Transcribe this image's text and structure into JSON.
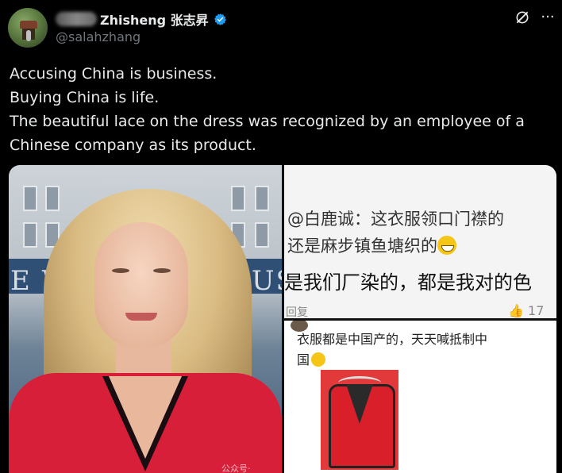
{
  "author": {
    "display_name": "Zhisheng 张志昇",
    "handle": "@salahzhang",
    "verified": true
  },
  "header_icons": {
    "grok": "grok-icon",
    "more": "more-icon",
    "more_glyph": "···"
  },
  "tweet": {
    "lines": [
      "Accusing China is business.",
      "Buying China is life.",
      "The beautiful lace on the dress was recognized by an employee of a",
      "Chinese company as its product."
    ]
  },
  "media": {
    "left": {
      "backdrop_letters": "E W",
      "backdrop_letters2": "OUS",
      "backdrop_small": "W",
      "watermark": "公众号·"
    },
    "right_top": {
      "line1": "@白鹿诚：这衣服领口门襟的",
      "line2": "还是麻步镇鱼塘织的",
      "line3": "是我们厂染的，都是我对的色",
      "reply": "回复",
      "likes": "17"
    },
    "right_bottom": {
      "line1": "衣服都是中国产的，天天喊抵制中",
      "line2": "国"
    }
  },
  "colors": {
    "background": "#000000",
    "text": "#e7e9ea",
    "muted": "#71767b",
    "verified": "#1d9bf0"
  }
}
